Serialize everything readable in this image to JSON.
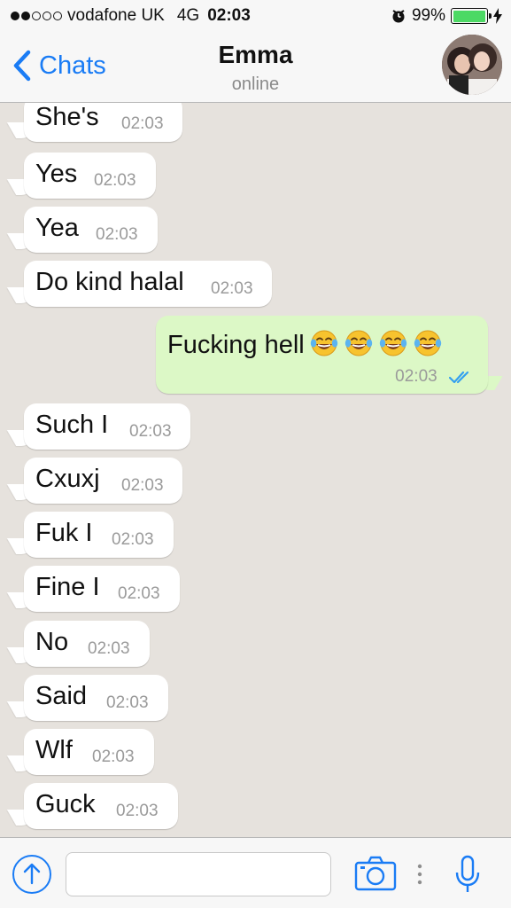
{
  "status": {
    "carrier": "vodafone UK",
    "network": "4G",
    "time": "02:03",
    "battery": "99%",
    "battery_level": 0.99,
    "signal_bars_filled": 2,
    "signal_bars_total": 5
  },
  "nav": {
    "back_label": "Chats",
    "contact_name": "Emma",
    "contact_status": "online"
  },
  "messages": [
    {
      "dir": "in",
      "text": "She's",
      "time": "02:03"
    },
    {
      "dir": "in",
      "text": "Yes",
      "time": "02:03"
    },
    {
      "dir": "in",
      "text": "Yea",
      "time": "02:03"
    },
    {
      "dir": "in",
      "text": "Do kind halal",
      "time": "02:03"
    },
    {
      "dir": "out",
      "text": "Fucking hell",
      "emoji": "😂😂😂😂",
      "time": "02:03",
      "read": true
    },
    {
      "dir": "in",
      "text": "Such I",
      "time": "02:03"
    },
    {
      "dir": "in",
      "text": "Cxuxj",
      "time": "02:03"
    },
    {
      "dir": "in",
      "text": "Fuk I",
      "time": "02:03"
    },
    {
      "dir": "in",
      "text": "Fine I",
      "time": "02:03"
    },
    {
      "dir": "in",
      "text": "No",
      "time": "02:03"
    },
    {
      "dir": "in",
      "text": "Said",
      "time": "02:03"
    },
    {
      "dir": "in",
      "text": "Wlf",
      "time": "02:03"
    },
    {
      "dir": "in",
      "text": "Guck",
      "time": "02:03"
    }
  ],
  "input": {
    "placeholder": "",
    "icons": [
      "share-icon",
      "camera-icon",
      "more-icon",
      "microphone-icon"
    ]
  },
  "colors": {
    "accent": "#1a7cf5",
    "outgoing_bubble": "#dcf8c6",
    "incoming_bubble": "#ffffff",
    "chat_background": "#e6e2dd",
    "battery": "#4cd964"
  }
}
